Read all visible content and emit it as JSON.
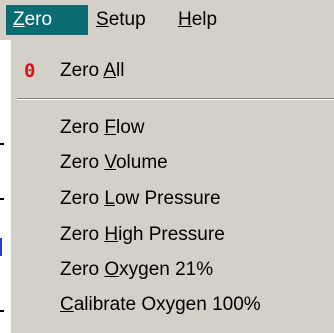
{
  "menubar": {
    "items": [
      {
        "prefix": "",
        "accel": "Z",
        "suffix": "ero"
      },
      {
        "prefix": "",
        "accel": "S",
        "suffix": "etup"
      },
      {
        "prefix": "",
        "accel": "H",
        "suffix": "elp"
      }
    ],
    "active_color": "#0a6b72"
  },
  "zero_menu": {
    "zero_all": {
      "icon_glyph": "0",
      "icon_color": "#e0101a",
      "prefix": "Zero ",
      "accel": "A",
      "suffix": "ll"
    },
    "items": [
      {
        "prefix": "Zero ",
        "accel": "F",
        "suffix": "low"
      },
      {
        "prefix": "Zero ",
        "accel": "V",
        "suffix": "olume"
      },
      {
        "prefix": "Zero ",
        "accel": "L",
        "suffix": "ow Pressure"
      },
      {
        "prefix": "Zero ",
        "accel": "H",
        "suffix": "igh Pressure"
      },
      {
        "prefix": "Zero ",
        "accel": "O",
        "suffix": "xygen 21%"
      },
      {
        "prefix": "",
        "accel": "C",
        "suffix": "alibrate Oxygen 100%"
      }
    ]
  }
}
